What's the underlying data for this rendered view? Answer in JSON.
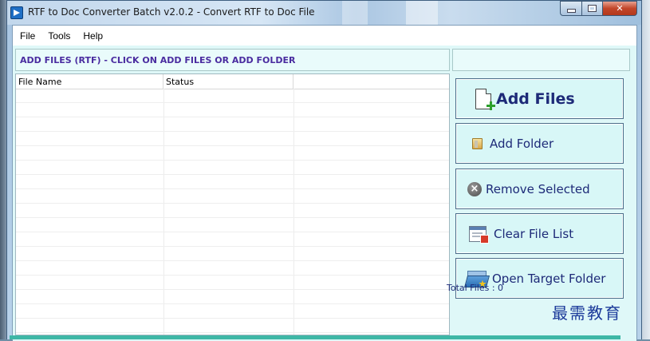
{
  "window": {
    "title": "RTF to Doc Converter Batch v2.0.2 -  Convert RTF to Doc File"
  },
  "menu": {
    "items": [
      "File",
      "Tools",
      "Help"
    ]
  },
  "file_panel": {
    "header": "ADD FILES (RTF) - CLICK ON ADD FILES OR ADD FOLDER",
    "columns": [
      "File Name",
      "Status",
      ""
    ],
    "rows": []
  },
  "actions": {
    "add_files": "Add Files",
    "add_folder": "Add Folder",
    "remove_selected": "Remove Selected",
    "clear_file_list": "Clear File List",
    "open_target_folder": "Open Target Folder"
  },
  "status": {
    "total_files": "Total Files : 0"
  },
  "watermark": {
    "text": "最需教育"
  },
  "colors": {
    "panel_bg": "#dff8f8",
    "header_text": "#4a2ca0",
    "button_text": "#1d2a78",
    "bottom_bar": "#3eb7a6"
  },
  "icons": {
    "app": "app-icon",
    "add_files": "add-file-icon",
    "add_folder": "folder-icon",
    "remove_selected": "remove-icon",
    "clear_file_list": "clear-list-icon",
    "open_target_folder": "open-folder-icon"
  }
}
